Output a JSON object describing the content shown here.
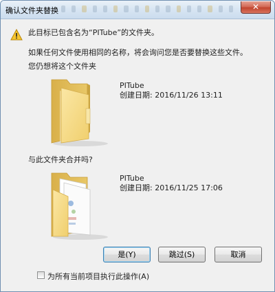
{
  "window": {
    "title": "确认文件夹替换",
    "close_symbol": "✕"
  },
  "message": {
    "headline": "此目标已包含名为“PITube”的文件夹。",
    "detail": "如果任何文件使用相同的名称，将会询问您是否要替换这些文件。",
    "question": "您仍想将这个文件夹"
  },
  "source_folder": {
    "icon": "folder-icon",
    "name": "PITube",
    "date_label": "创建日期:",
    "date_value": "2016/11/26 13:11"
  },
  "merge_question": "与此文件夹合并吗?",
  "target_folder": {
    "icon": "folder-with-files-icon",
    "name": "PITube",
    "date_label": "创建日期:",
    "date_value": "2016/11/25 17:06"
  },
  "buttons": {
    "yes": "是(Y)",
    "skip": "跳过(S)",
    "cancel": "取消"
  },
  "apply_all": {
    "label": "为所有当前项目执行此操作(A)",
    "checked": false
  },
  "colors": {
    "folder_front": "#f3d77c",
    "folder_back": "#e2bd55",
    "warning": "#f6c52d",
    "default_button_border": "#3c7fb1"
  }
}
